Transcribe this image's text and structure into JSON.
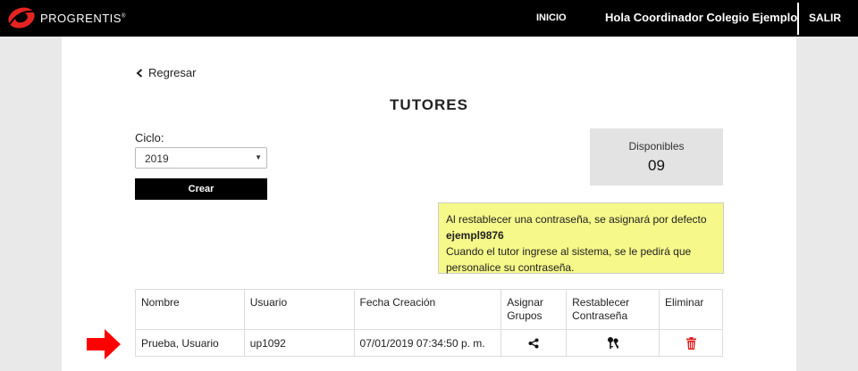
{
  "header": {
    "brand": "PROGRENTIS",
    "brand_mark": "®",
    "nav_inicio": "INICIO",
    "greeting": "Hola Coordinador Colegio Ejemplo",
    "logout": "SALIR"
  },
  "page": {
    "back_label": "Regresar",
    "title": "TUTORES"
  },
  "form": {
    "ciclo_label": "Ciclo:",
    "ciclo_value": "2019",
    "crear_label": "Crear"
  },
  "disponibles": {
    "label": "Disponibles",
    "count": "09"
  },
  "notice": {
    "line1": "Al restablecer una contraseña, se asignará por defecto",
    "default_password": "ejempl9876",
    "line2": "Cuando el tutor ingrese al sistema, se le pedirá que personalice su contraseña."
  },
  "table": {
    "headers": {
      "nombre": "Nombre",
      "usuario": "Usuario",
      "fecha": "Fecha Creación",
      "asignar_1": "Asignar",
      "asignar_2": "Grupos",
      "restablecer_1": "Restablecer",
      "restablecer_2": "Contraseña",
      "eliminar": "Eliminar"
    },
    "rows": [
      {
        "nombre": "Prueba, Usuario",
        "usuario": "up1092",
        "fecha": "07/01/2019 07:34:50 p. m.",
        "asignar_icon": "share-icon",
        "restablecer_icon": "keys-icon",
        "eliminar_icon": "trash-icon"
      }
    ]
  },
  "colors": {
    "topbar": "#000000",
    "logo_red": "#e52421",
    "notice_bg": "#f6f889",
    "trash_red": "#e02020",
    "arrow_red": "#ff0000"
  }
}
